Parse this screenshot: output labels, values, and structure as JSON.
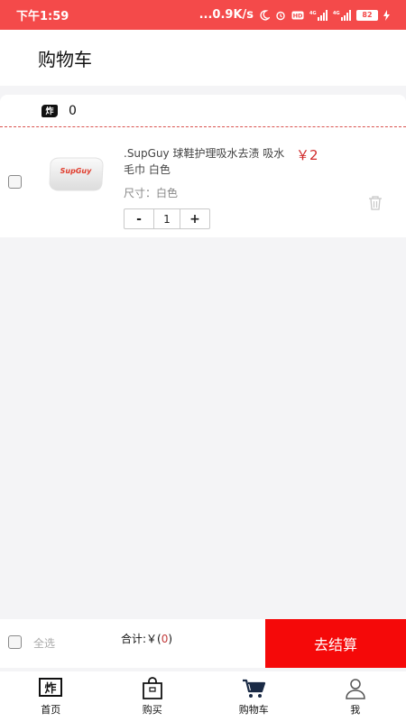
{
  "status_bar": {
    "time": "下午1:59",
    "network_speed": "...0.9K/s",
    "battery": "82",
    "signal1": "4G",
    "signal2": "4G"
  },
  "header": {
    "title": "购物车"
  },
  "store": {
    "count": "0",
    "logo_text": "炸"
  },
  "cart_items": [
    {
      "name": ".SupGuy 球鞋护理吸水去渍 吸水毛巾 白色",
      "price": "￥2",
      "spec": "尺寸：白色",
      "quantity": "1",
      "brand_text": "SupGuy"
    }
  ],
  "stepper": {
    "minus": "-",
    "plus": "+"
  },
  "footer": {
    "select_all": "全选",
    "total_label": "合计:￥(",
    "total_amount": "0",
    "total_suffix": ")",
    "checkout": "去结算"
  },
  "tabs": [
    {
      "label": "首页",
      "icon": "home-icon"
    },
    {
      "label": "购买",
      "icon": "shopping-bag-icon"
    },
    {
      "label": "购物车",
      "icon": "cart-icon"
    },
    {
      "label": "我",
      "icon": "user-icon"
    }
  ],
  "colors": {
    "accent": "#f44a4a",
    "checkout": "#f50909",
    "price": "#d12b2b",
    "active_tab": "#1a2a45"
  }
}
